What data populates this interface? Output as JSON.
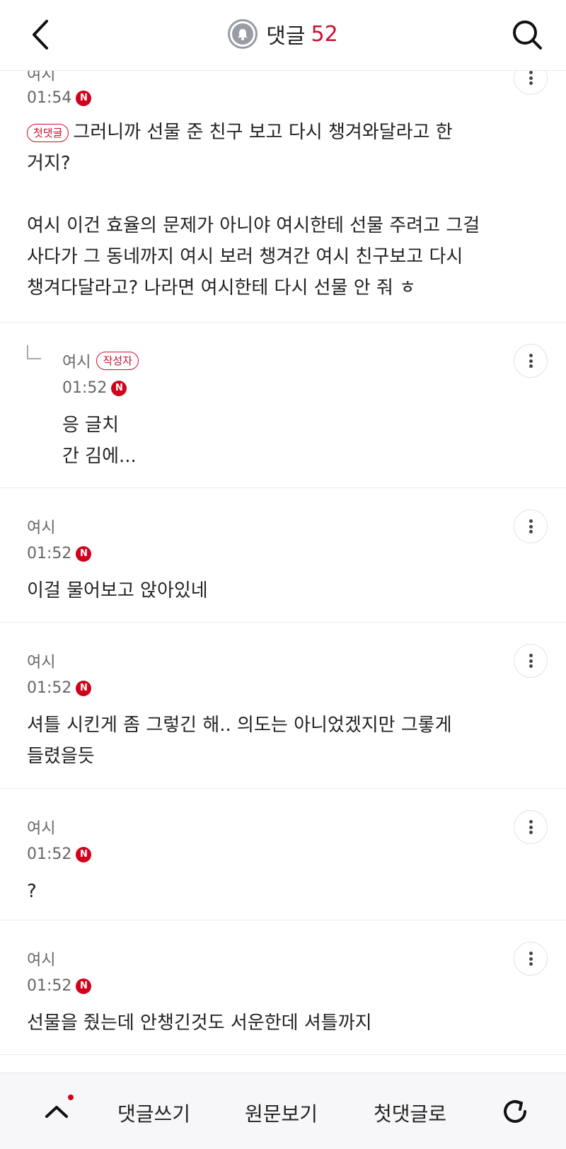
{
  "header": {
    "title": "댓글",
    "count": "52",
    "icons": {
      "back": "chevron-left-icon",
      "bell": "bell-icon",
      "search": "search-icon"
    }
  },
  "comments": [
    {
      "author": "여시",
      "time": "01:54",
      "new_badge": "N",
      "tag": "첫댓글",
      "lines": [
        "그러니까 선물 준 친구 보고 다시 챙겨와달라고 한",
        "거지?",
        "",
        "여시 이건 효율의 문제가 아니야 여시한테 선물 주려고 그걸",
        "사다가 그 동네까지 여시 보러 챙겨간 여시 친구보고 다시",
        "챙겨다달라고? 나라면 여시한테 다시 선물 안 줘 ㅎ"
      ]
    },
    {
      "author": "여시",
      "author_tag": "작성자",
      "time": "01:52",
      "new_badge": "N",
      "reply": true,
      "lines": [
        "응 글치",
        "간 김에..."
      ]
    },
    {
      "author": "여시",
      "time": "01:52",
      "new_badge": "N",
      "lines": [
        "이걸 물어보고 앉아있네"
      ]
    },
    {
      "author": "여시",
      "time": "01:52",
      "new_badge": "N",
      "lines": [
        "셔틀 시킨게 좀 그렇긴 해.. 의도는 아니었겠지만 그롷게",
        "들렸을듯"
      ]
    },
    {
      "author": "여시",
      "time": "01:52",
      "new_badge": "N",
      "lines": [
        "?"
      ]
    },
    {
      "author": "여시",
      "time": "01:52",
      "new_badge": "N",
      "lines": [
        "선물을 줬는데 안챙긴것도 서운한데 셔틀까지"
      ]
    }
  ],
  "bottom_bar": {
    "write": "댓글쓰기",
    "original": "원문보기",
    "first": "첫댓글로",
    "icons": {
      "up": "chevron-up-icon",
      "refresh": "refresh-icon"
    },
    "accent": "#d0021b"
  },
  "colors": {
    "accent": "#c8102e",
    "badge": "#d0021b",
    "meta": "#666666"
  }
}
